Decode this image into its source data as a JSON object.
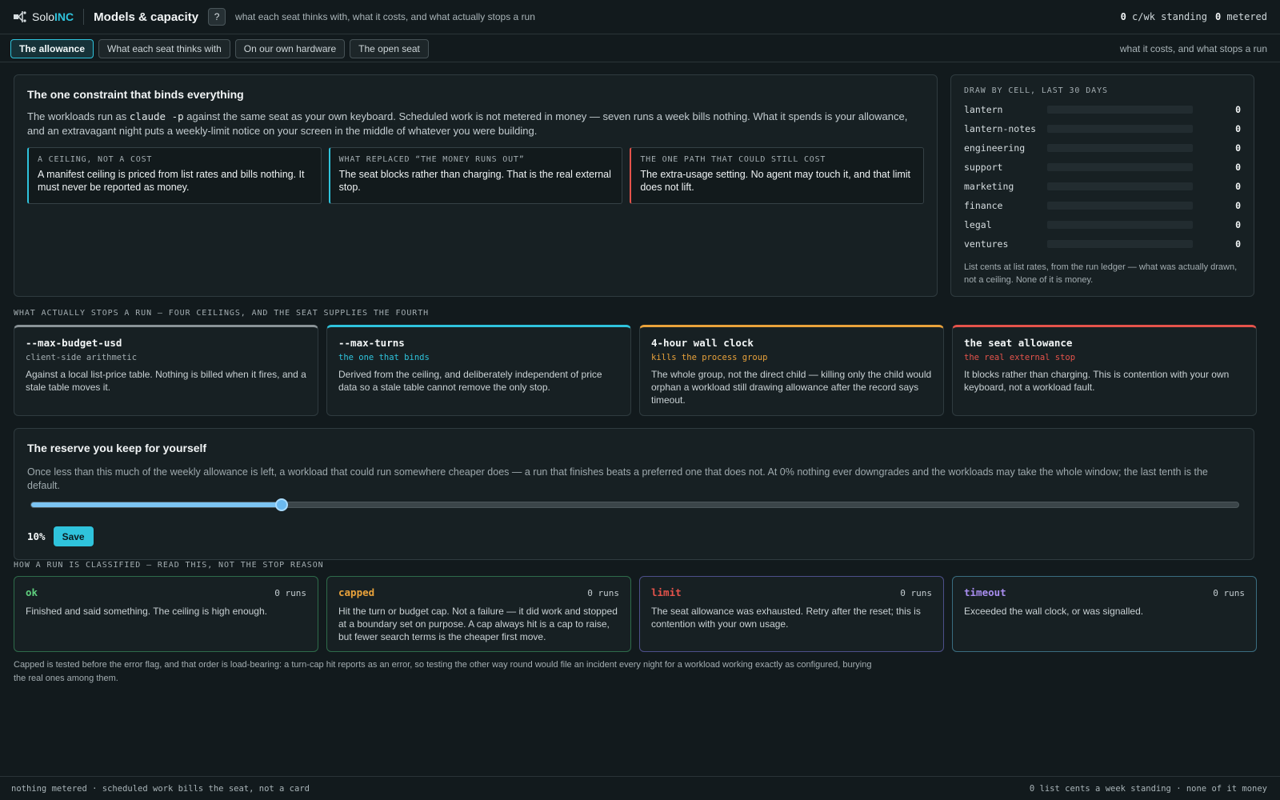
{
  "brand": {
    "name": "Solo",
    "suffix": "INC"
  },
  "page": {
    "title": "Models & capacity",
    "help_label": "?",
    "subtitle": "what each seat thinks with, what it costs, and what actually stops a run",
    "standing": {
      "value": "0",
      "label": "c/wk standing"
    },
    "metered": {
      "value": "0",
      "label": "metered"
    }
  },
  "tabs": [
    {
      "label": "The allowance",
      "active": true
    },
    {
      "label": "What each seat thinks with",
      "active": false
    },
    {
      "label": "On our own hardware",
      "active": false
    },
    {
      "label": "The open seat",
      "active": false
    }
  ],
  "tabs_right": "what it costs, and what stops a run",
  "constraint": {
    "title": "The one constraint that binds everything",
    "text_before": "The workloads run as ",
    "code": "claude -p",
    "text_after": " against the same seat as your own keyboard. Scheduled work is not metered in money — seven runs a week bills nothing. What it spends is your allowance, and an extravagant night puts a weekly-limit notice on your screen in the middle of whatever you were building.",
    "callouts": [
      {
        "title": "A ceiling, not a cost",
        "body": "A manifest ceiling is priced from list rates and bills nothing. It must never be reported as money.",
        "accent": "#2fc3dc"
      },
      {
        "title": "What replaced “the money runs out”",
        "body": "The seat blocks rather than charging. That is the real external stop.",
        "accent": "#2fc3dc"
      },
      {
        "title": "The one path that could still cost",
        "body": "The extra-usage setting. No agent may touch it, and that limit does not lift.",
        "accent": "#e5534b"
      }
    ]
  },
  "draw": {
    "title": "Draw by cell, last 30 days",
    "rows": [
      {
        "name": "lantern",
        "value": "0",
        "fraction": 0
      },
      {
        "name": "lantern-notes",
        "value": "0",
        "fraction": 0
      },
      {
        "name": "engineering",
        "value": "0",
        "fraction": 0
      },
      {
        "name": "support",
        "value": "0",
        "fraction": 0
      },
      {
        "name": "marketing",
        "value": "0",
        "fraction": 0
      },
      {
        "name": "finance",
        "value": "0",
        "fraction": 0
      },
      {
        "name": "legal",
        "value": "0",
        "fraction": 0
      },
      {
        "name": "ventures",
        "value": "0",
        "fraction": 0
      }
    ],
    "note": "List cents at list rates, from the run ledger — what was actually drawn, not a ceiling. None of it is money."
  },
  "ceilings_label": "What actually stops a run — four ceilings, and the seat supplies the fourth",
  "ceilings": [
    {
      "title": "--max-budget-usd",
      "sub": "client-side arithmetic",
      "body": "Against a local list-price table. Nothing is billed when it fires, and a stale table moves it.",
      "accent": "#8a9397",
      "sub_color": "#a3adb1"
    },
    {
      "title": "--max-turns",
      "sub": "the one that binds",
      "body": "Derived from the ceiling, and deliberately independent of price data so a stale table cannot remove the only stop.",
      "accent": "#2fc3dc",
      "sub_color": "#2fc3dc"
    },
    {
      "title": "4-hour wall clock",
      "sub": "kills the process group",
      "body": "The whole group, not the direct child — killing only the child would orphan a workload still drawing allowance after the record says timeout.",
      "accent": "#e9a23b",
      "sub_color": "#e9a23b"
    },
    {
      "title": "the seat allowance",
      "sub": "the real external stop",
      "body": "It blocks rather than charging. This is contention with your own keyboard, not a workload fault.",
      "accent": "#e5534b",
      "sub_color": "#e5534b"
    }
  ],
  "reserve": {
    "title": "The reserve you keep for yourself",
    "desc": "Once less than this much of the weekly allowance is left, a workload that could run somewhere cheaper does — a run that finishes beats a preferred one that does not. At 0% nothing ever downgrades and the workloads may take the whole window; the last tenth is the default.",
    "percent_label": "10%",
    "slider_fraction": 0.208,
    "save_label": "Save"
  },
  "classified_label": "How a run is classified — read this, not the stop reason",
  "classes": [
    {
      "title": "ok",
      "count": "0 runs",
      "body": "Finished and said something. The ceiling is high enough.",
      "color": "#5fcf7e",
      "border": "#2e6b4a"
    },
    {
      "title": "capped",
      "count": "0 runs",
      "body": "Hit the turn or budget cap. Not a failure — it did work and stopped at a boundary set on purpose. A cap always hit is a cap to raise, but fewer search terms is the cheaper first move.",
      "color": "#e9a23b",
      "border": "#2e6b4a"
    },
    {
      "title": "limit",
      "count": "0 runs",
      "body": "The seat allowance was exhausted. Retry after the reset; this is contention with your own usage.",
      "color": "#e5534b",
      "border": "#4d4f8a"
    },
    {
      "title": "timeout",
      "count": "0 runs",
      "body": "Exceeded the wall clock, or was signalled.",
      "color": "#a98ef0",
      "border": "#3a6d80"
    }
  ],
  "footnote": "Capped is tested before the error flag, and that order is load-bearing: a turn-cap hit reports as an error, so testing the other way round would file an incident every night for a workload working exactly as configured, burying the real ones among them.",
  "status": {
    "left": "nothing metered · scheduled work bills the seat, not a card",
    "right": "0 list cents a week standing · none of it money"
  }
}
